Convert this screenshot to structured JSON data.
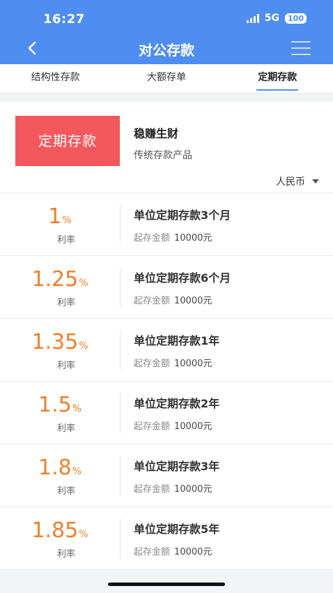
{
  "status_bar": {
    "time": "16:27",
    "network": "5G",
    "battery": "100"
  },
  "nav": {
    "title": "对公存款"
  },
  "tabs": [
    {
      "label": "结构性存款"
    },
    {
      "label": "大额存单"
    },
    {
      "label": "定期存款"
    }
  ],
  "product": {
    "badge": "定期存款",
    "name": "稳赚生财",
    "desc": "传统存款产品",
    "currency": "人民币"
  },
  "deposits": [
    {
      "rate": "1",
      "unit": "%",
      "rate_label": "利率",
      "title": "单位定期存款3个月",
      "min_label": "起存金额",
      "min_amount": "10000元"
    },
    {
      "rate": "1.25",
      "unit": "%",
      "rate_label": "利率",
      "title": "单位定期存款6个月",
      "min_label": "起存金额",
      "min_amount": "10000元"
    },
    {
      "rate": "1.35",
      "unit": "%",
      "rate_label": "利率",
      "title": "单位定期存款1年",
      "min_label": "起存金额",
      "min_amount": "10000元"
    },
    {
      "rate": "1.5",
      "unit": "%",
      "rate_label": "利率",
      "title": "单位定期存款2年",
      "min_label": "起存金额",
      "min_amount": "10000元"
    },
    {
      "rate": "1.8",
      "unit": "%",
      "rate_label": "利率",
      "title": "单位定期存款3年",
      "min_label": "起存金额",
      "min_amount": "10000元"
    },
    {
      "rate": "1.85",
      "unit": "%",
      "rate_label": "利率",
      "title": "单位定期存款5年",
      "min_label": "起存金额",
      "min_amount": "10000元"
    }
  ],
  "colors": {
    "header": "#4f8ef0",
    "badge": "#f3585c",
    "rate": "#ee7f2c"
  }
}
